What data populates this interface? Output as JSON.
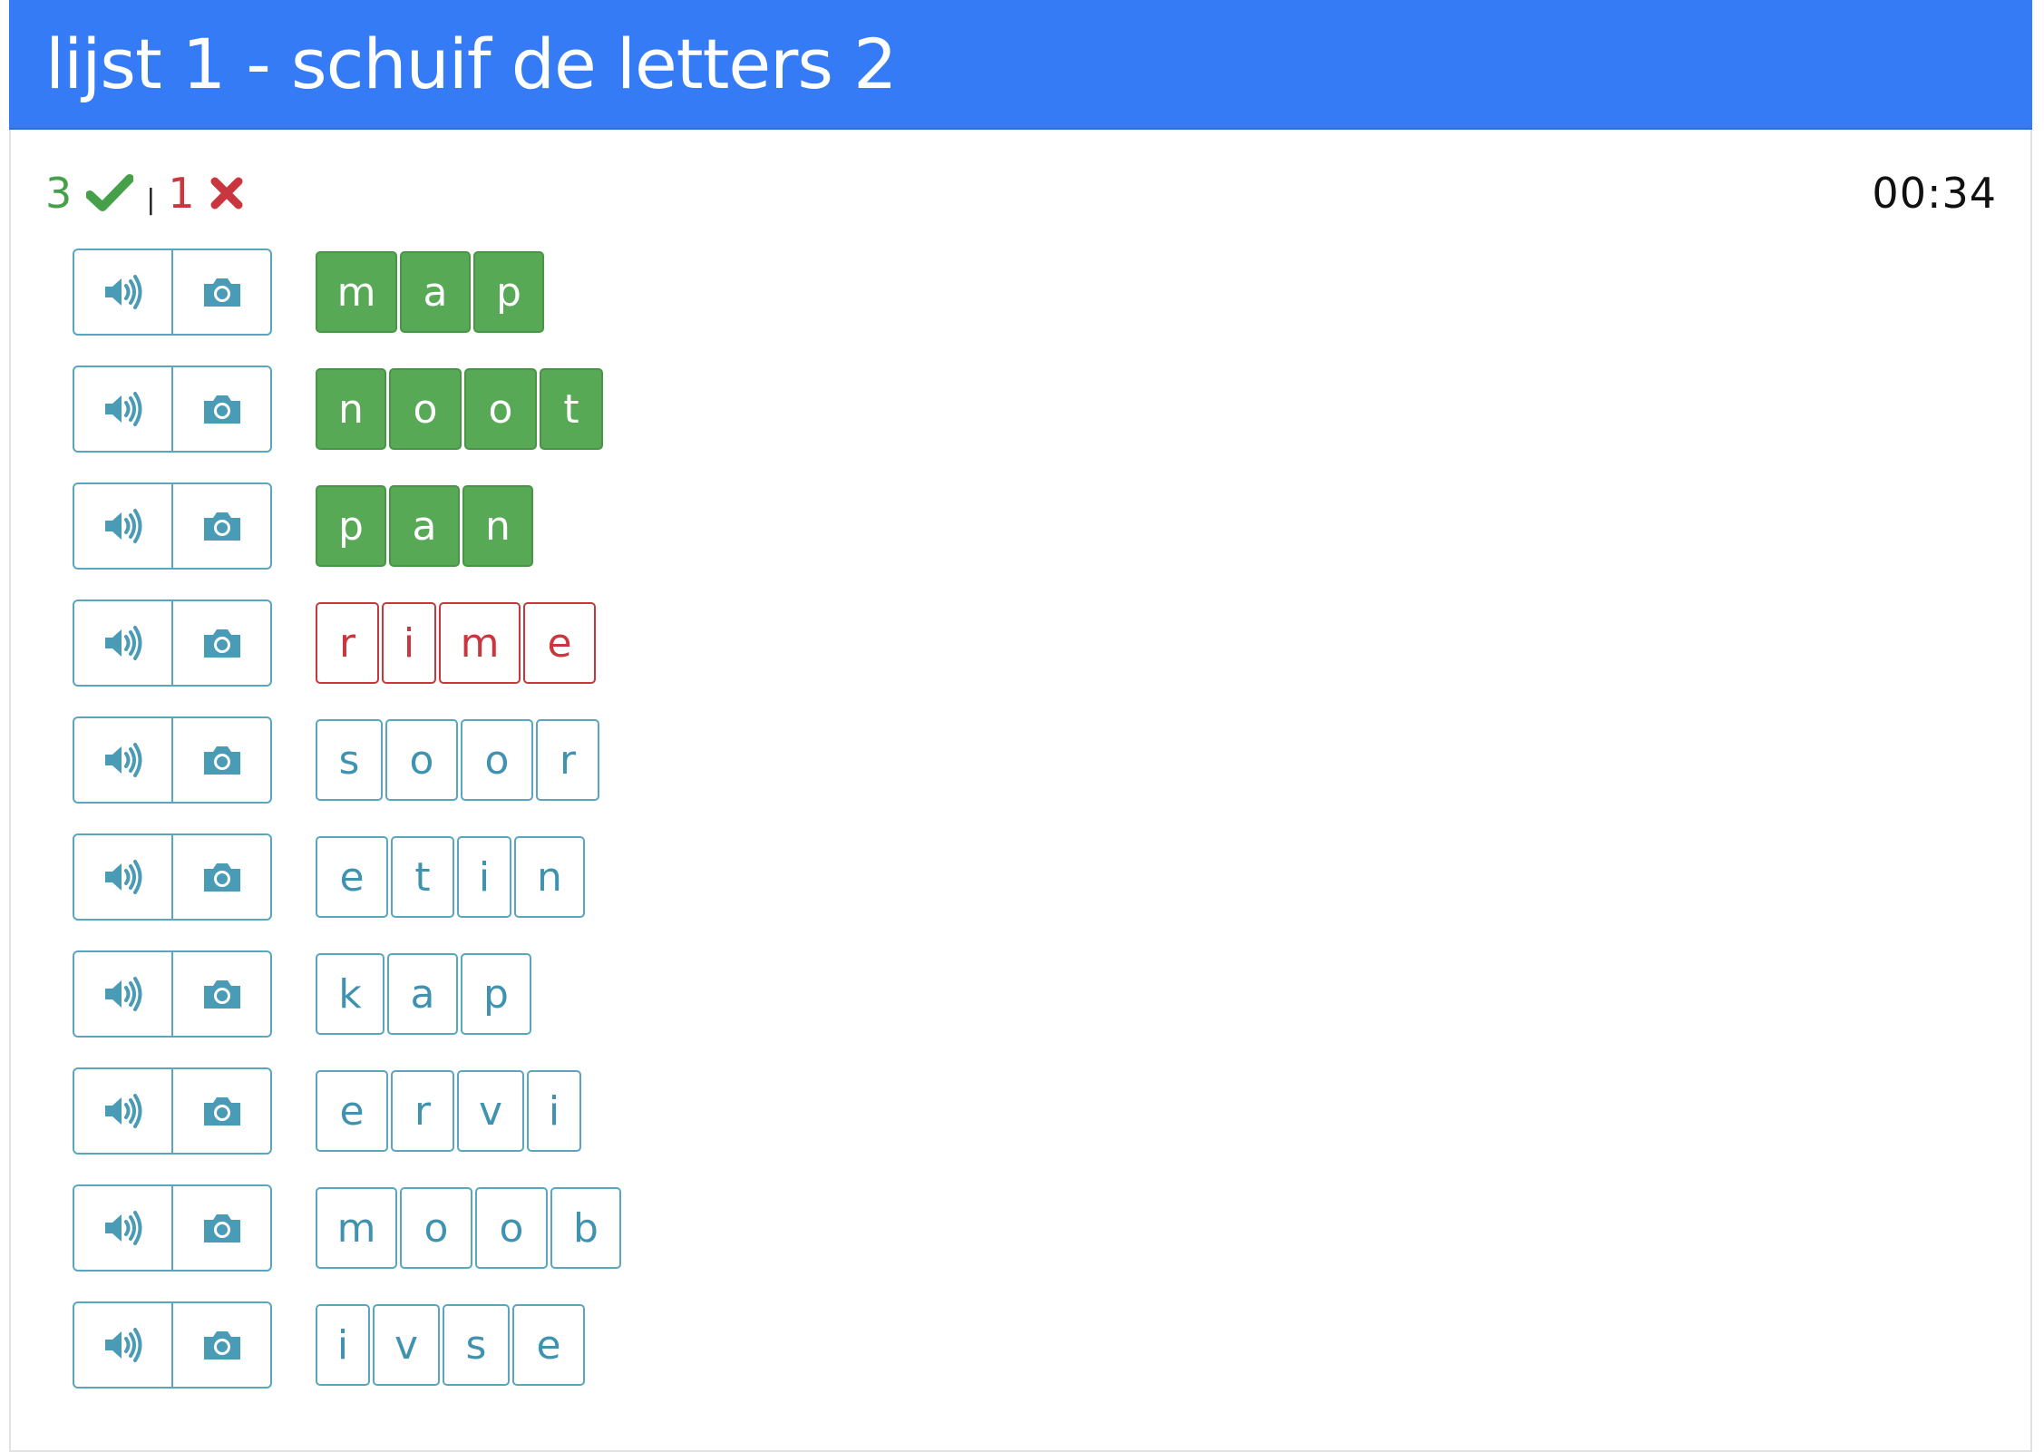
{
  "header": {
    "title": "lijst 1 - schuif de letters 2"
  },
  "score": {
    "correct": "3",
    "wrong": "1",
    "separator": "|"
  },
  "timer": "00:34",
  "colors": {
    "header": "#357bf6",
    "correct": "#57a955",
    "wrong": "#c9363d",
    "teal": "#3f93b0"
  },
  "rows": [
    {
      "state": "correct",
      "letters": [
        "m",
        "a",
        "p"
      ]
    },
    {
      "state": "correct",
      "letters": [
        "n",
        "o",
        "o",
        "t"
      ]
    },
    {
      "state": "correct",
      "letters": [
        "p",
        "a",
        "n"
      ]
    },
    {
      "state": "wrong",
      "letters": [
        "r",
        "i",
        "m",
        "e"
      ]
    },
    {
      "state": "open",
      "letters": [
        "s",
        "o",
        "o",
        "r"
      ]
    },
    {
      "state": "open",
      "letters": [
        "e",
        "t",
        "i",
        "n"
      ]
    },
    {
      "state": "open",
      "letters": [
        "k",
        "a",
        "p"
      ]
    },
    {
      "state": "open",
      "letters": [
        "e",
        "r",
        "v",
        "i"
      ]
    },
    {
      "state": "open",
      "letters": [
        "m",
        "o",
        "o",
        "b"
      ]
    },
    {
      "state": "open",
      "letters": [
        "i",
        "v",
        "s",
        "e"
      ]
    }
  ],
  "icons": {
    "audio": "speaker-icon",
    "image": "camera-icon",
    "correct": "check-icon",
    "wrong": "x-icon"
  }
}
